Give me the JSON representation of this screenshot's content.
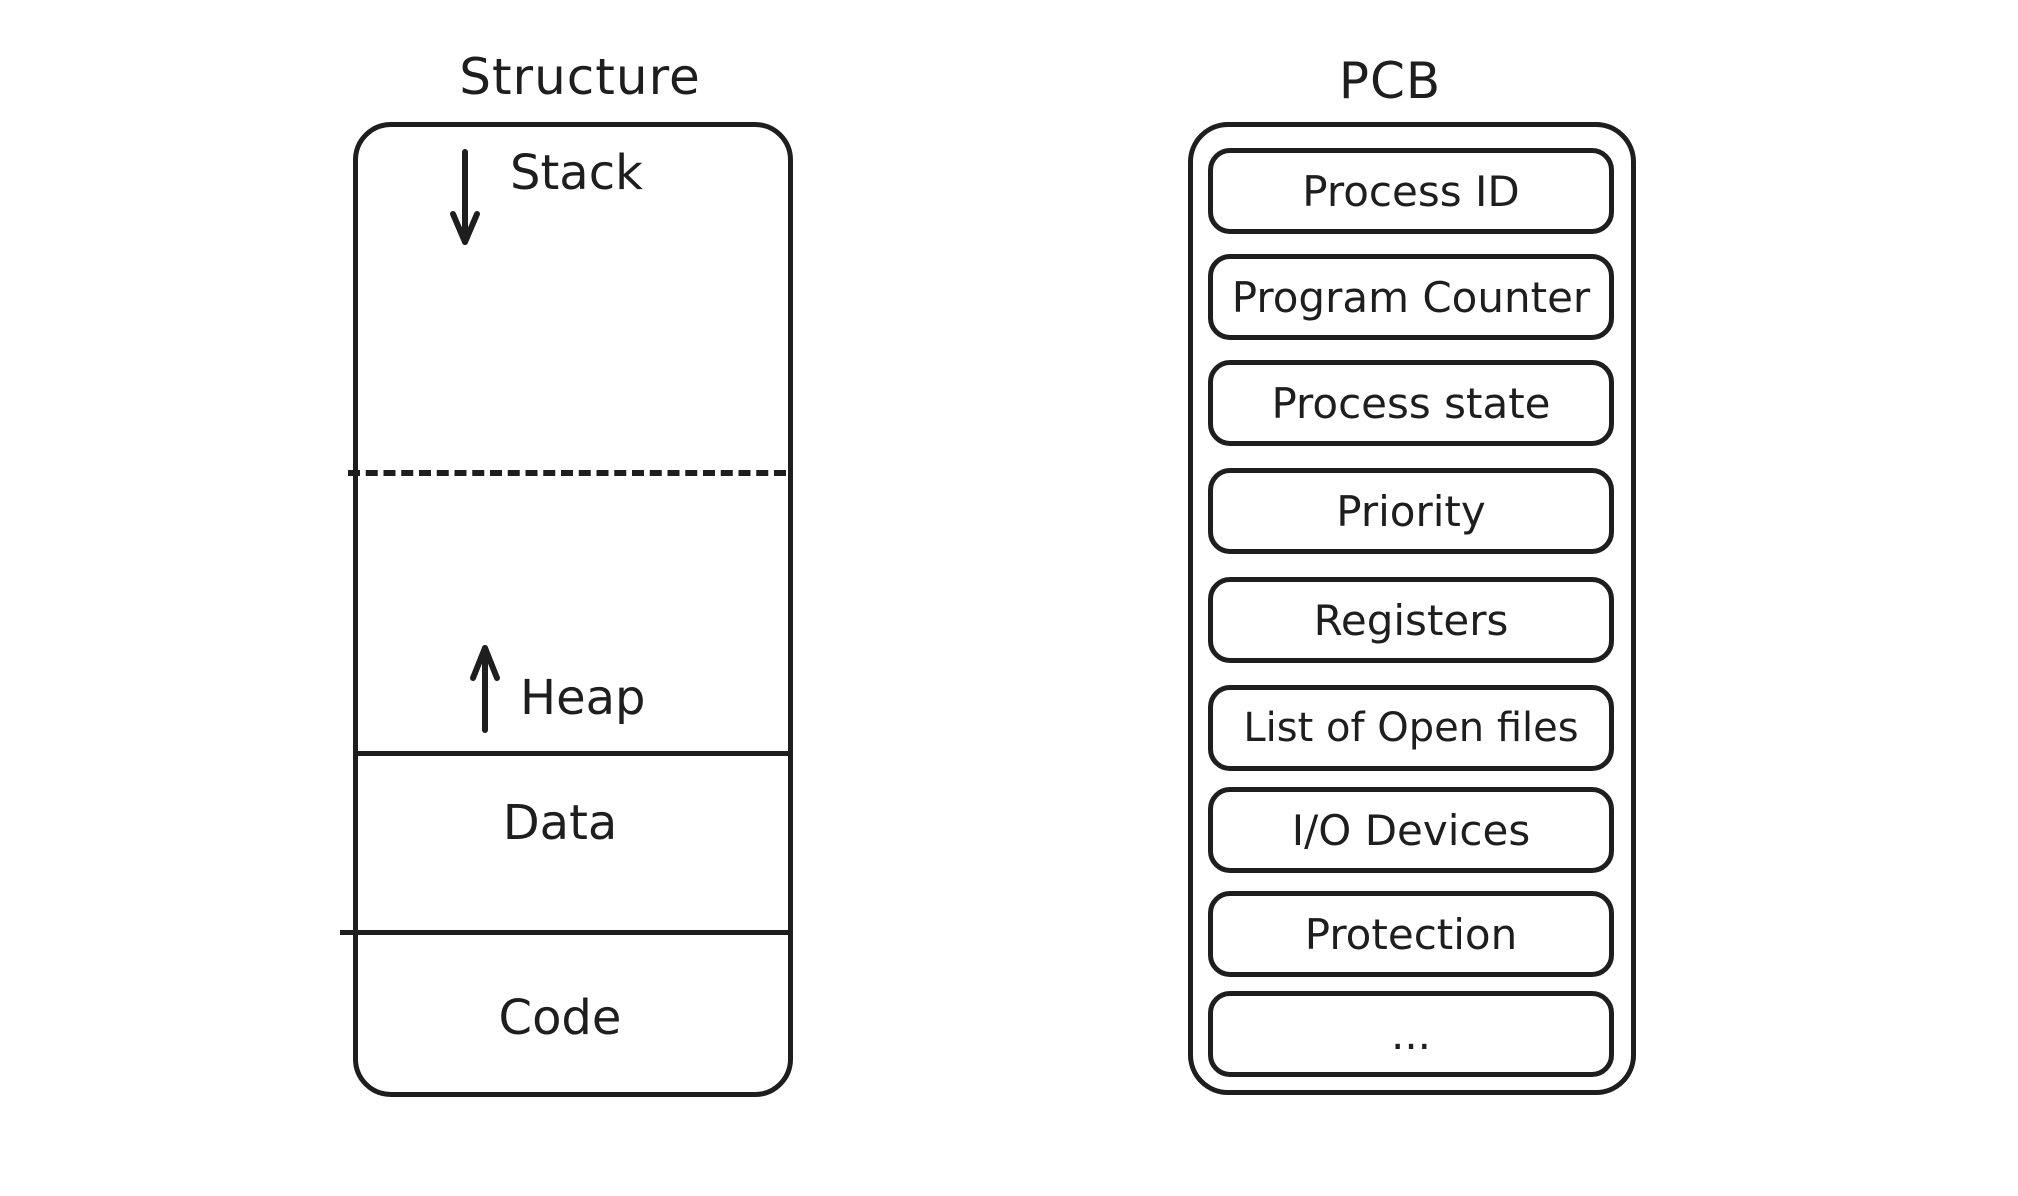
{
  "structure": {
    "title": "Structure",
    "sections": {
      "stack": "Stack",
      "heap": "Heap",
      "data": "Data",
      "code": "Code"
    },
    "arrows": {
      "stack": "arrow-down",
      "heap": "arrow-up"
    }
  },
  "pcb": {
    "title": "PCB",
    "fields": [
      "Process ID",
      "Program Counter",
      "Process state",
      "Priority",
      "Registers",
      "List of Open files",
      "I/O Devices",
      "Protection",
      "..."
    ]
  }
}
